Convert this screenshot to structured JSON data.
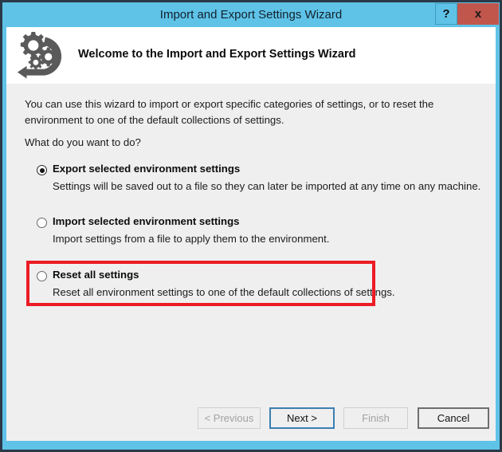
{
  "window": {
    "title": "Import and Export Settings Wizard",
    "help_label": "?",
    "close_label": "x",
    "frame_color": "#5fc3e8",
    "close_color": "#c0564c"
  },
  "header": {
    "icon": "settings-gears-import-export-icon",
    "heading": "Welcome to the Import and Export Settings Wizard"
  },
  "body": {
    "intro": "You can use this wizard to import or export specific categories of settings, or to reset the environment to one of the default collections of settings.",
    "question": "What do you want to do?",
    "options": [
      {
        "label": "Export selected environment settings",
        "description": "Settings will be saved out to a file so they can later be imported at any time on any machine.",
        "selected": true
      },
      {
        "label": "Import selected environment settings",
        "description": "Import settings from a file to apply them to the environment.",
        "selected": false
      },
      {
        "label": "Reset all settings",
        "description": "Reset all environment settings to one of the default collections of settings.",
        "selected": false
      }
    ]
  },
  "annotation": {
    "color": "#ec1c24",
    "target": "Reset all settings"
  },
  "footer": {
    "buttons": [
      {
        "label": "< Previous",
        "state": "disabled"
      },
      {
        "label": "Next >",
        "state": "focused"
      },
      {
        "label": "Finish",
        "state": "disabled"
      },
      {
        "label": "Cancel",
        "state": "default"
      }
    ]
  }
}
